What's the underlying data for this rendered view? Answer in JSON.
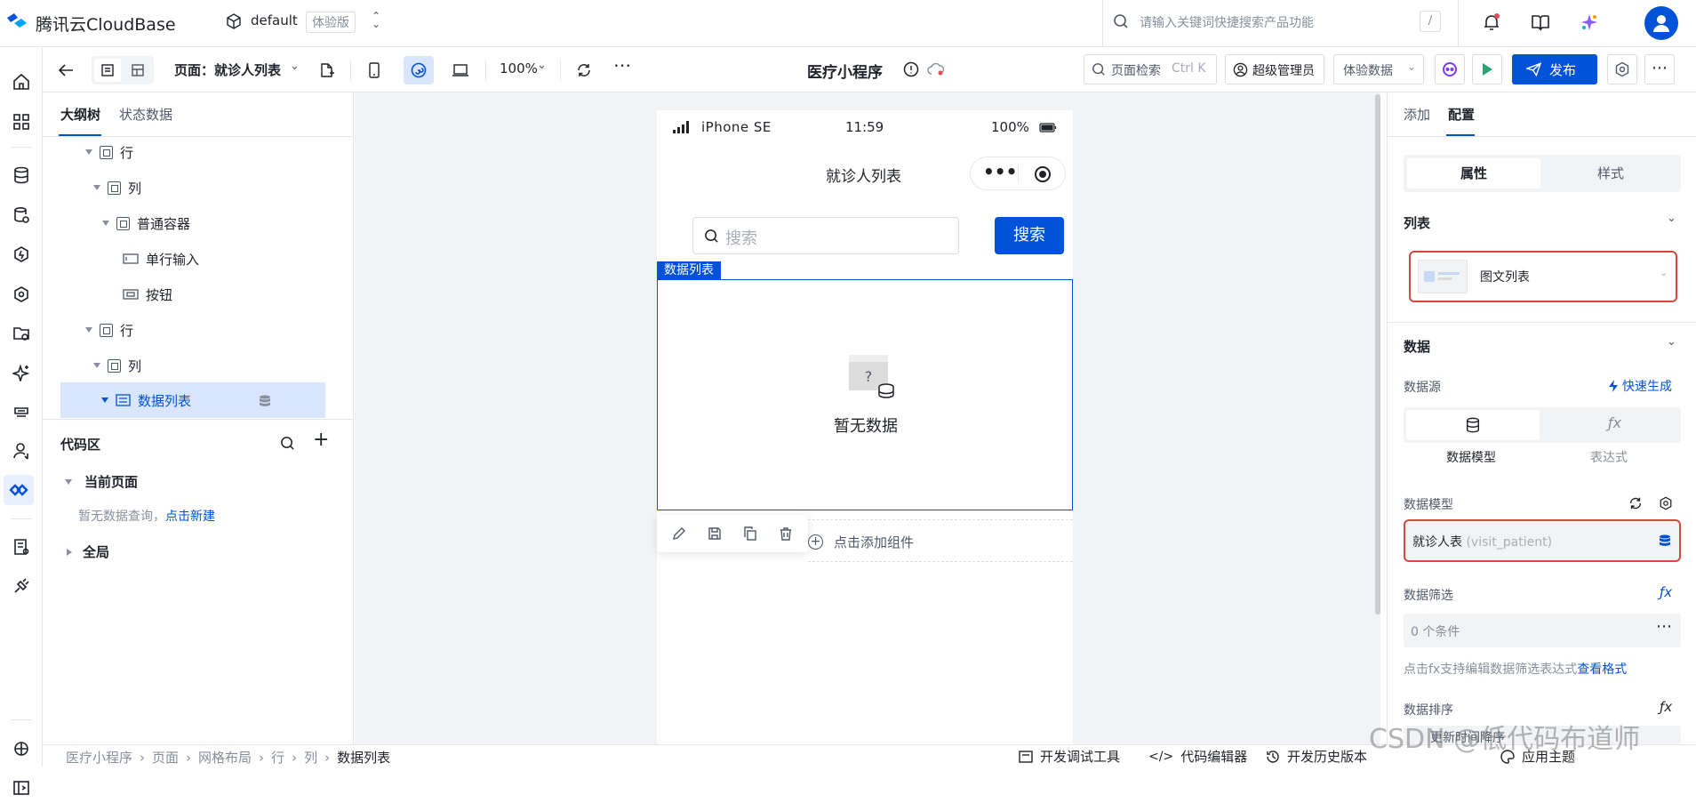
{
  "header": {
    "brand": "腾讯云CloudBase",
    "env_name": "default",
    "env_badge": "体验版",
    "search_placeholder": "请输入关键词快捷搜索产品功能",
    "search_shortcut": "/"
  },
  "toolbar": {
    "page_label": "页面：就诊人列表",
    "zoom": "100%",
    "app_title": "医疗小程序",
    "page_search_label": "页面检索",
    "page_search_shortcut": "Ctrl K",
    "admin_label": "超级管理员",
    "data_mode_label": "体验数据",
    "publish_label": "发布"
  },
  "left_panel": {
    "tabs": [
      "大纲树",
      "状态数据"
    ],
    "tree": [
      {
        "label": "行"
      },
      {
        "label": "列"
      },
      {
        "label": "普通容器"
      },
      {
        "label": "单行输入"
      },
      {
        "label": "按钮"
      },
      {
        "label": "行"
      },
      {
        "label": "列"
      },
      {
        "label": "数据列表"
      }
    ],
    "code_area": {
      "title": "代码区",
      "current_page": "当前页面",
      "empty_text": "暂无数据查询，",
      "create_link": "点击新建",
      "global": "全局"
    }
  },
  "phone": {
    "carrier": "iPhone SE",
    "time": "11:59",
    "battery": "100%",
    "nav_title": "就诊人列表",
    "search_placeholder": "搜索",
    "search_button": "搜索",
    "list_tag": "数据列表",
    "empty_text": "暂无数据",
    "empty_icon_mark": "?",
    "add_component": "点击添加组件"
  },
  "right_panel": {
    "tabs": [
      "添加",
      "配置"
    ],
    "seg": [
      "属性",
      "样式"
    ],
    "list_section": "列表",
    "list_style_value": "图文列表",
    "data_section": "数据",
    "datasource_label": "数据源",
    "quick_gen": "快速生成",
    "source_options": [
      "数据模型",
      "表达式"
    ],
    "data_model_label": "数据模型",
    "data_model_value": "就诊人表",
    "data_model_key": "(visit_patient)",
    "filter_label": "数据筛选",
    "filter_value": "0 个条件",
    "filter_hint": "点击fx支持编辑数据筛选表达式",
    "filter_hint_link": "查看格式",
    "sort_label": "数据排序",
    "sort_value": "更新时间降序"
  },
  "bottom": {
    "breadcrumb": [
      "医疗小程序",
      "页面",
      "网格布局",
      "行",
      "列",
      "数据列表"
    ],
    "tools": [
      "开发调试工具",
      "代码编辑器",
      "开发历史版本",
      "应用主题"
    ]
  },
  "watermark": "CSDN @低代码布道师",
  "colors": {
    "primary": "#0052d9",
    "green": "#2ba471",
    "highlight": "#d9e6fd",
    "red_outline": "#d54941"
  }
}
